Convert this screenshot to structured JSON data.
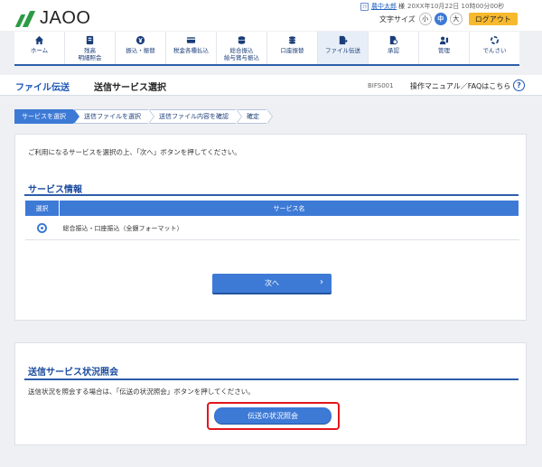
{
  "header": {
    "logo_text": "JAOO",
    "user_icon": "ﾌﾗ",
    "user_name": "農中太郎",
    "user_honorific": "様",
    "login_time": "20XX年10月22日 10時00分00秒",
    "font_size_label": "文字サイズ",
    "font_sizes": [
      "小",
      "中",
      "大"
    ],
    "active_font_size": "中",
    "logout_label": "ログアウト"
  },
  "nav": {
    "items": [
      {
        "label": "ホーム",
        "icon": "home-icon"
      },
      {
        "label": "残高\n明細照会",
        "icon": "passbook-icon"
      },
      {
        "label": "振込・振替",
        "icon": "yen-transfer-icon"
      },
      {
        "label": "税金各種払込",
        "icon": "card-payment-icon"
      },
      {
        "label": "総合振込\n給与賞与振込",
        "icon": "coins-icon"
      },
      {
        "label": "口座振替",
        "icon": "coin-stack-icon"
      },
      {
        "label": "ファイル伝送",
        "icon": "file-transfer-icon"
      },
      {
        "label": "承認",
        "icon": "approval-icon"
      },
      {
        "label": "管理",
        "icon": "admin-icon"
      },
      {
        "label": "でんさい",
        "icon": "densai-icon"
      }
    ],
    "active_index": 6
  },
  "title_bar": {
    "category": "ファイル伝送",
    "page_title": "送信サービス選択",
    "screen_id": "BIFS001",
    "help_text": "操作マニュアル／FAQはこちら",
    "help_icon": "?"
  },
  "stepper": {
    "steps": [
      "サービスを選択",
      "送信ファイルを選択",
      "送信ファイル内容を確認",
      "確定"
    ],
    "active_index": 0
  },
  "service_selection": {
    "instruction": "ご利用になるサービスを選択の上、「次へ」ボタンを押してください。",
    "section_title": "サービス情報",
    "table_headers": {
      "select": "選択",
      "service_name": "サービス名"
    },
    "rows": [
      {
        "selected": true,
        "service_name": "総合振込・口座振込（全銀フォーマット）"
      }
    ],
    "next_button": "次へ",
    "next_arrow": "›"
  },
  "status_inquiry": {
    "section_title": "送信サービス状況照会",
    "instruction": "送信状況を照会する場合は、「伝送の状況照会」ボタンを押してください。",
    "button_label": "伝送の状況照会",
    "highlight_color": "#e2161d"
  },
  "colors": {
    "primary": "#3d7ad6",
    "navy": "#1a4a9e",
    "accent_logout": "#f7b92e",
    "brand_green": "#2d9b45"
  }
}
